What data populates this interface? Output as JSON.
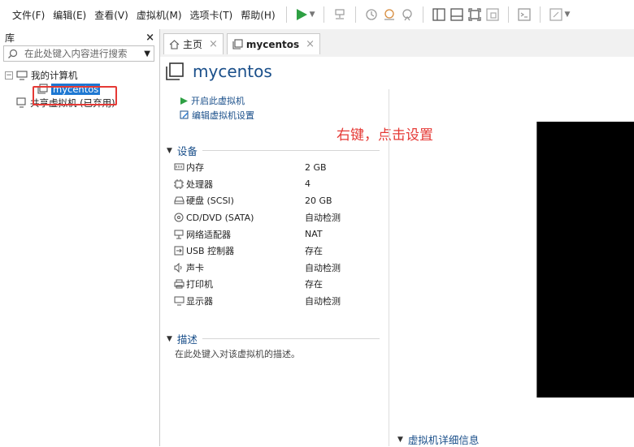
{
  "menu": {
    "items": [
      "文件(F)",
      "编辑(E)",
      "查看(V)",
      "虚拟机(M)",
      "选项卡(T)",
      "帮助(H)"
    ]
  },
  "library": {
    "title": "库",
    "close_glyph": "×",
    "search_placeholder": "在此处键入内容进行搜索",
    "tree": {
      "root_label": "我的计算机",
      "vm_label": "mycentos",
      "shared_label": "共享虚拟机 (已弃用)"
    }
  },
  "tabs": [
    {
      "label": "主页",
      "active": false
    },
    {
      "label": "mycentos",
      "active": true
    }
  ],
  "vm": {
    "title": "mycentos",
    "actions": {
      "start": "开启此虚拟机",
      "edit": "编辑虚拟机设置"
    }
  },
  "annotation": "右键，点击设置",
  "devices": {
    "section_title": "设备",
    "items": [
      {
        "name": "内存",
        "value": "2 GB",
        "icon": "memory-icon"
      },
      {
        "name": "处理器",
        "value": "4",
        "icon": "cpu-icon"
      },
      {
        "name": "硬盘 (SCSI)",
        "value": "20 GB",
        "icon": "hdd-icon"
      },
      {
        "name": "CD/DVD (SATA)",
        "value": "自动检测",
        "icon": "cd-icon"
      },
      {
        "name": "网络适配器",
        "value": "NAT",
        "icon": "network-icon"
      },
      {
        "name": "USB 控制器",
        "value": "存在",
        "icon": "usb-icon"
      },
      {
        "name": "声卡",
        "value": "自动检测",
        "icon": "sound-icon"
      },
      {
        "name": "打印机",
        "value": "存在",
        "icon": "printer-icon"
      },
      {
        "name": "显示器",
        "value": "自动检测",
        "icon": "display-icon"
      }
    ]
  },
  "description": {
    "section_title": "描述",
    "placeholder": "在此处键入对该虚拟机的描述。"
  },
  "details": {
    "section_title": "虚拟机详细信息"
  },
  "colors": {
    "accent": "#1a4f8a",
    "selection": "#1e78d2",
    "annotation": "#e53935",
    "play": "#2ea043"
  }
}
